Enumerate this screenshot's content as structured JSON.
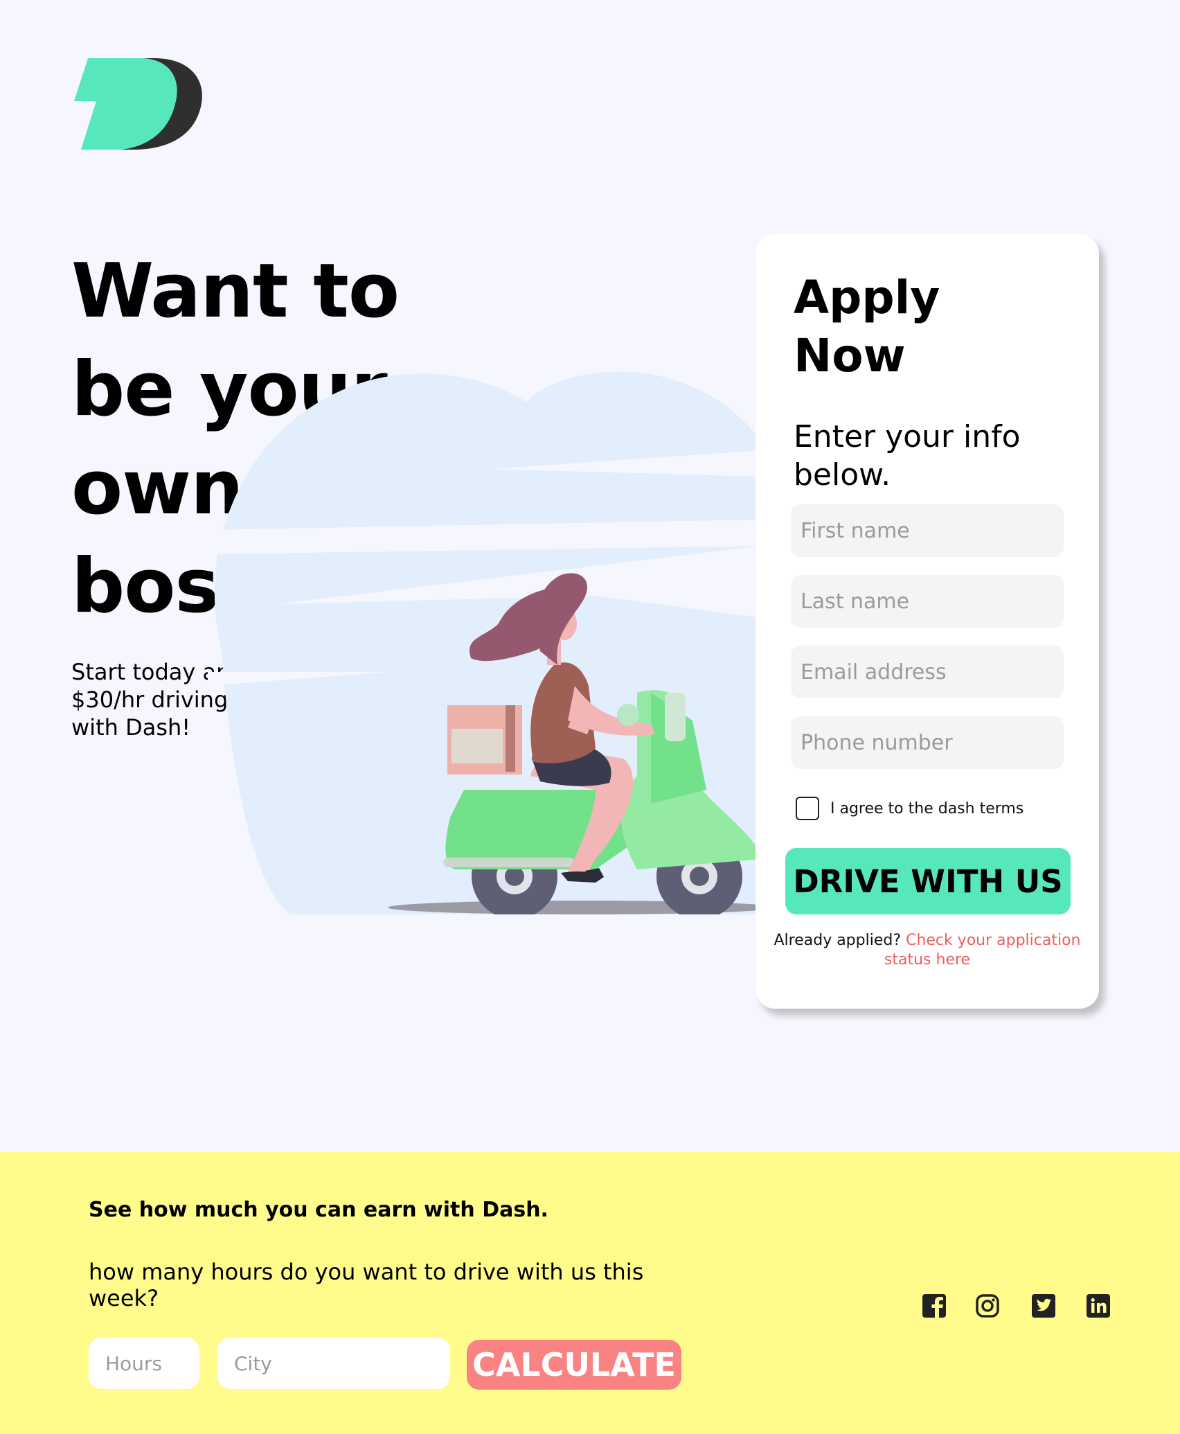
{
  "brand": {
    "logo_icon": "dash-logo-icon",
    "primary": "#57e7bd",
    "dark": "#333333"
  },
  "hero": {
    "headline": "Want to be your own boss?",
    "subtext": "Start today and make up to $30/hr driving your own vehicle with Dash!"
  },
  "apply": {
    "title": "Apply Now",
    "subtitle": "Enter your info below.",
    "first_name_placeholder": "First name",
    "last_name_placeholder": "Last name",
    "email_placeholder": "Email address",
    "phone_placeholder": "Phone number",
    "agree_label": "I agree to the dash terms",
    "submit_label": "DRIVE WITH US",
    "already_text": "Already applied?",
    "status_link": "Check your application status here"
  },
  "earn": {
    "title": "See how much you can earn with Dash.",
    "question": "how many hours do you want to drive with us this week?",
    "hours_placeholder": "Hours",
    "city_placeholder": "City",
    "calculate_label": "CALCULATE",
    "background": "#fffc8c",
    "button_color": "#f98383"
  },
  "social": {
    "icons": [
      "facebook-icon",
      "instagram-icon",
      "twitter-icon",
      "linkedin-icon"
    ]
  }
}
